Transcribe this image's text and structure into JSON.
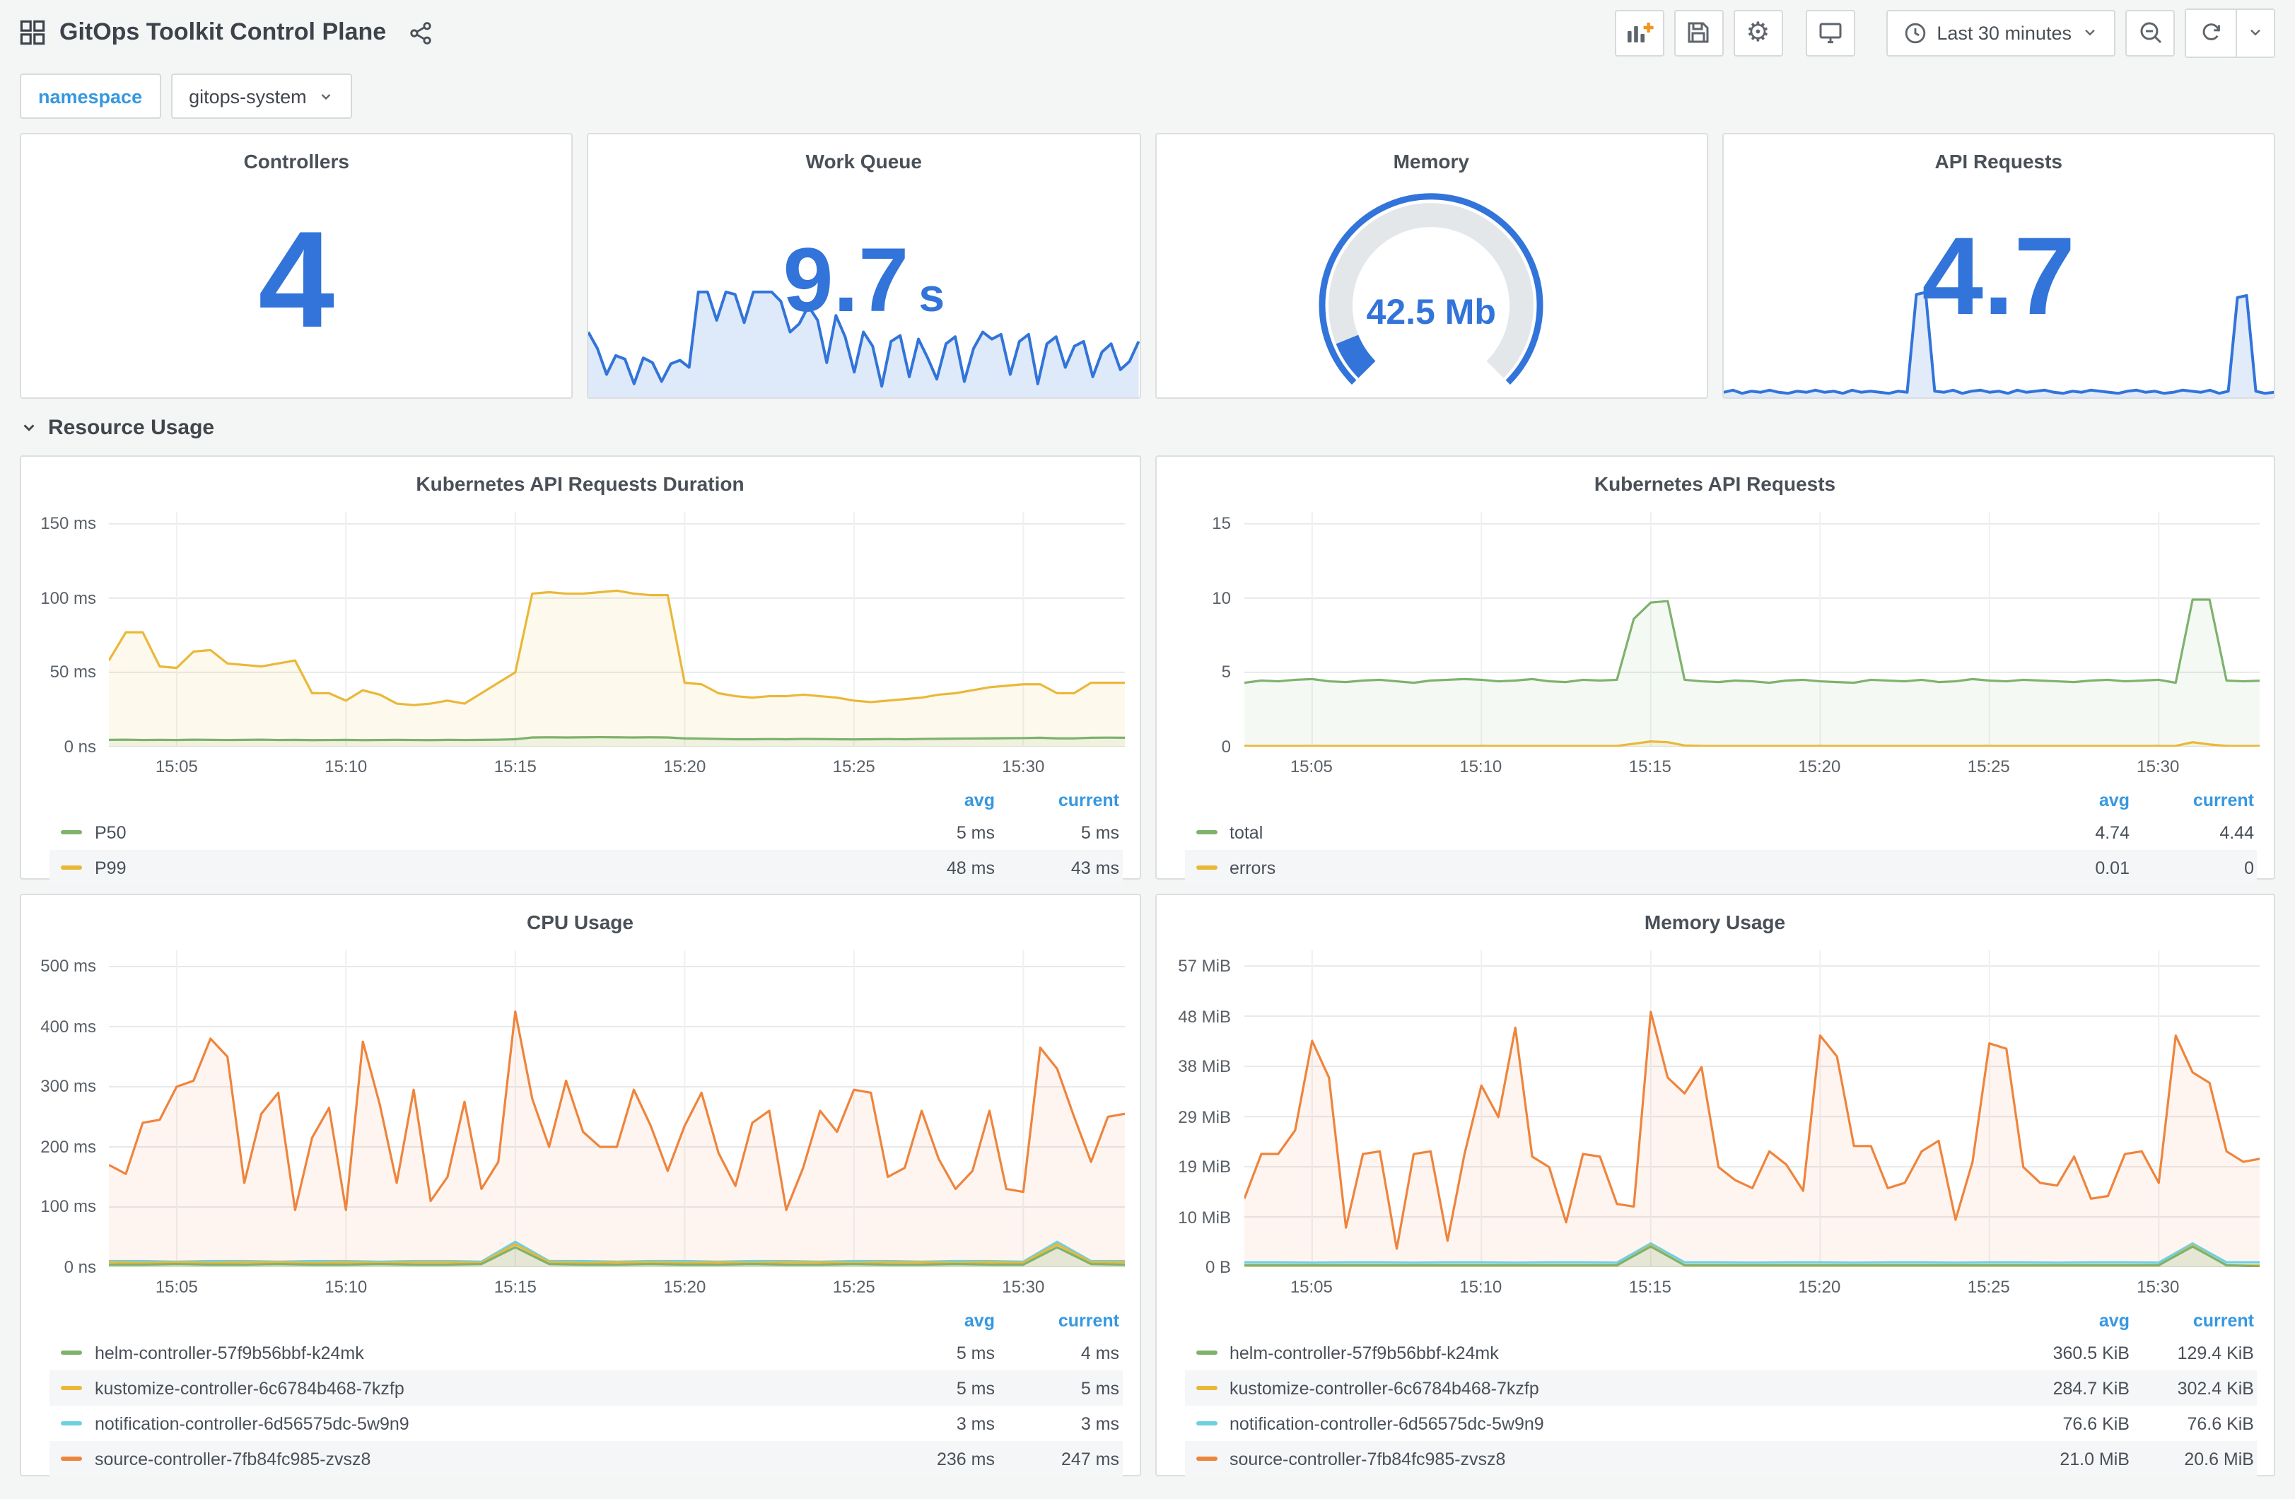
{
  "header": {
    "title": "GitOps Toolkit Control Plane",
    "time_range": "Last 30 minutes"
  },
  "variables": {
    "label": "namespace",
    "value": "gitops-system"
  },
  "row_section": {
    "title": "Resource Usage"
  },
  "legend": {
    "avg_label": "avg",
    "current_label": "current"
  },
  "colors": {
    "accent_blue": "#3274D9",
    "link_blue": "#3698e0",
    "green": "#7EB26D",
    "yellow": "#EAB839",
    "cyan": "#6ED0E0",
    "orange": "#EF843C"
  },
  "stats": [
    {
      "title": "Controllers",
      "value": "4"
    },
    {
      "title": "Work Queue",
      "value": "9.7",
      "unit": "s",
      "spark": {
        "max": 10.5,
        "color": "#3274D9",
        "fill_opacity": 0.16,
        "values": [
          5.6,
          4.2,
          2.0,
          3.6,
          3.3,
          1.2,
          3.4,
          3.0,
          1.4,
          2.9,
          3.2,
          2.6,
          9.0,
          9.0,
          6.6,
          9.0,
          8.8,
          6.4,
          9.0,
          9.0,
          9.0,
          8.2,
          5.6,
          6.3,
          7.8,
          6.6,
          3.0,
          7.0,
          5.2,
          2.2,
          5.6,
          4.4,
          1.0,
          4.8,
          5.3,
          1.8,
          5.0,
          3.4,
          1.6,
          4.6,
          5.2,
          1.4,
          4.2,
          5.6,
          5.0,
          5.4,
          2.0,
          4.8,
          5.4,
          1.2,
          4.6,
          5.2,
          2.6,
          4.4,
          4.8,
          1.8,
          3.9,
          4.6,
          2.4,
          3.1,
          4.8
        ]
      }
    },
    {
      "title": "Memory",
      "value": "42.5 Mb",
      "gauge": {
        "fraction": 0.085
      }
    },
    {
      "title": "API Requests",
      "value": "4.7",
      "spark": {
        "max": 10.5,
        "color": "#3274D9",
        "fill_opacity": 0.14,
        "values": [
          0.5,
          0.7,
          0.4,
          0.6,
          0.5,
          0.7,
          0.5,
          0.4,
          0.6,
          0.5,
          0.7,
          0.5,
          0.6,
          0.4,
          0.7,
          0.5,
          0.6,
          0.5,
          0.4,
          0.6,
          0.5,
          9.8,
          10,
          0.6,
          0.5,
          0.7,
          0.4,
          0.6,
          0.7,
          0.5,
          0.6,
          0.4,
          0.7,
          0.5,
          0.6,
          0.7,
          0.5,
          0.4,
          0.6,
          0.5,
          0.7,
          0.6,
          0.5,
          0.4,
          0.6,
          0.7,
          0.5,
          0.6,
          0.4,
          0.5,
          0.7,
          0.6,
          0.5,
          0.7,
          0.4,
          0.6,
          9.5,
          9.7,
          0.6,
          0.4,
          0.5
        ]
      }
    }
  ],
  "chart_data": [
    {
      "type": "line",
      "title": "Kubernetes API Requests Duration",
      "time_domain": [
        "15:03",
        "15:33"
      ],
      "ymax": 158,
      "y_ticks": [
        {
          "value": 0,
          "label": "0 ns"
        },
        {
          "value": 50,
          "label": "50 ms"
        },
        {
          "value": 100,
          "label": "100 ms"
        },
        {
          "value": 150,
          "label": "150 ms"
        }
      ],
      "x_ticks": [
        {
          "frac": 0.0667,
          "label": "15:05"
        },
        {
          "frac": 0.2333,
          "label": "15:10"
        },
        {
          "frac": 0.4,
          "label": "15:15"
        },
        {
          "frac": 0.5667,
          "label": "15:20"
        },
        {
          "frac": 0.7333,
          "label": "15:25"
        },
        {
          "frac": 0.9,
          "label": "15:30"
        }
      ],
      "draw_order": [
        1,
        0
      ],
      "series": [
        {
          "name": "P50",
          "color": "#7EB26D",
          "fill_opacity": 0.1,
          "avg": "5 ms",
          "current": "5 ms",
          "values": [
            4.6,
            4.7,
            4.5,
            4.6,
            4.5,
            4.7,
            4.6,
            4.5,
            4.6,
            4.7,
            4.5,
            4.6,
            4.4,
            4.5,
            4.6,
            4.4,
            4.5,
            4.6,
            4.5,
            4.4,
            4.6,
            4.5,
            4.6,
            4.7,
            5.0,
            6.2,
            6.3,
            6.2,
            6.3,
            6.4,
            6.3,
            6.2,
            6.3,
            6.2,
            5.6,
            5.4,
            5.2,
            5.0,
            5.0,
            5.1,
            5.0,
            5.2,
            5.1,
            5.0,
            4.9,
            5.0,
            5.1,
            5.0,
            5.2,
            5.3,
            5.4,
            5.5,
            5.6,
            5.7,
            5.8,
            6.0,
            5.6,
            5.6,
            6.0,
            6.1,
            6.0
          ]
        },
        {
          "name": "P99",
          "color": "#EAB839",
          "fill_opacity": 0.09,
          "avg": "48 ms",
          "current": "43 ms",
          "values": [
            58,
            77,
            77,
            54,
            53,
            64,
            65,
            56,
            55,
            54,
            56,
            58,
            36,
            36,
            31,
            38,
            35,
            29,
            28,
            29,
            31,
            29,
            36,
            43,
            50,
            103,
            104,
            103,
            103,
            104,
            105,
            103,
            102,
            102,
            43,
            42,
            36,
            34,
            33,
            34,
            34,
            35,
            34,
            33,
            31,
            30,
            31,
            32,
            33,
            35,
            36,
            38,
            40,
            41,
            42,
            42,
            36,
            36,
            43,
            43,
            43
          ]
        }
      ]
    },
    {
      "type": "line",
      "title": "Kubernetes API Requests",
      "time_domain": [
        "15:03",
        "15:33"
      ],
      "ymax": 15.8,
      "y_ticks": [
        {
          "value": 0,
          "label": "0"
        },
        {
          "value": 5,
          "label": "5"
        },
        {
          "value": 10,
          "label": "10"
        },
        {
          "value": 15,
          "label": "15"
        }
      ],
      "x_ticks": [
        {
          "frac": 0.0667,
          "label": "15:05"
        },
        {
          "frac": 0.2333,
          "label": "15:10"
        },
        {
          "frac": 0.4,
          "label": "15:15"
        },
        {
          "frac": 0.5667,
          "label": "15:20"
        },
        {
          "frac": 0.7333,
          "label": "15:25"
        },
        {
          "frac": 0.9,
          "label": "15:30"
        }
      ],
      "draw_order": [
        0,
        1
      ],
      "series": [
        {
          "name": "total",
          "color": "#7EB26D",
          "fill_opacity": 0.08,
          "avg": "4.74",
          "current": "4.44",
          "values": [
            4.3,
            4.45,
            4.4,
            4.5,
            4.55,
            4.4,
            4.35,
            4.45,
            4.5,
            4.4,
            4.3,
            4.45,
            4.5,
            4.55,
            4.5,
            4.4,
            4.45,
            4.55,
            4.4,
            4.35,
            4.5,
            4.45,
            4.5,
            8.6,
            9.7,
            9.8,
            4.5,
            4.4,
            4.35,
            4.45,
            4.4,
            4.3,
            4.45,
            4.5,
            4.4,
            4.35,
            4.3,
            4.5,
            4.45,
            4.4,
            4.5,
            4.35,
            4.4,
            4.55,
            4.45,
            4.4,
            4.5,
            4.45,
            4.4,
            4.35,
            4.45,
            4.5,
            4.4,
            4.45,
            4.5,
            4.3,
            9.9,
            9.9,
            4.45,
            4.4,
            4.44
          ]
        },
        {
          "name": "errors",
          "color": "#EAB839",
          "fill_opacity": 0.12,
          "avg": "0.01",
          "current": "0",
          "values": [
            0.05,
            0.05,
            0.05,
            0.05,
            0.05,
            0.05,
            0.05,
            0.05,
            0.05,
            0.05,
            0.05,
            0.05,
            0.05,
            0.05,
            0.05,
            0.05,
            0.05,
            0.05,
            0.05,
            0.05,
            0.05,
            0.05,
            0.05,
            0.2,
            0.35,
            0.3,
            0.08,
            0.05,
            0.05,
            0.05,
            0.05,
            0.05,
            0.05,
            0.05,
            0.05,
            0.05,
            0.05,
            0.05,
            0.05,
            0.05,
            0.05,
            0.05,
            0.05,
            0.05,
            0.05,
            0.05,
            0.05,
            0.05,
            0.05,
            0.05,
            0.05,
            0.05,
            0.05,
            0.05,
            0.05,
            0.05,
            0.3,
            0.15,
            0.05,
            0.05,
            0.05
          ]
        }
      ]
    },
    {
      "type": "line",
      "title": "CPU Usage",
      "time_domain": [
        "15:03",
        "15:33"
      ],
      "ymax": 527,
      "y_ticks": [
        {
          "value": 0,
          "label": "0 ns"
        },
        {
          "value": 100,
          "label": "100 ms"
        },
        {
          "value": 200,
          "label": "200 ms"
        },
        {
          "value": 300,
          "label": "300 ms"
        },
        {
          "value": 400,
          "label": "400 ms"
        },
        {
          "value": 500,
          "label": "500 ms"
        }
      ],
      "x_ticks": [
        {
          "frac": 0.0667,
          "label": "15:05"
        },
        {
          "frac": 0.2333,
          "label": "15:10"
        },
        {
          "frac": 0.4,
          "label": "15:15"
        },
        {
          "frac": 0.5667,
          "label": "15:20"
        },
        {
          "frac": 0.7333,
          "label": "15:25"
        },
        {
          "frac": 0.9,
          "label": "15:30"
        }
      ],
      "draw_order": [
        3,
        2,
        1,
        0
      ],
      "series": [
        {
          "name": "helm-controller-57f9b56bbf-k24mk",
          "color": "#7EB26D",
          "fill_opacity": 0.1,
          "avg": "5 ms",
          "current": "4 ms",
          "values": [
            4,
            4,
            5,
            4,
            4,
            5,
            4,
            4,
            5,
            4,
            4,
            5,
            33,
            5,
            4,
            4,
            5,
            4,
            4,
            5,
            4,
            4,
            5,
            4,
            4,
            5,
            4,
            4,
            33,
            5,
            4
          ]
        },
        {
          "name": "kustomize-controller-6c6784b468-7kzfp",
          "color": "#EAB839",
          "fill_opacity": 0.08,
          "avg": "5 ms",
          "current": "5 ms",
          "values": [
            8,
            7,
            8,
            7,
            8,
            8,
            7,
            8,
            7,
            8,
            8,
            7,
            38,
            8,
            7,
            8,
            8,
            7,
            8,
            7,
            8,
            8,
            7,
            8,
            8,
            7,
            8,
            7,
            38,
            8,
            8
          ]
        },
        {
          "name": "notification-controller-6d56575dc-5w9n9",
          "color": "#6ED0E0",
          "fill_opacity": 0.08,
          "avg": "3 ms",
          "current": "3 ms",
          "values": [
            10,
            10,
            9,
            10,
            10,
            9,
            10,
            10,
            9,
            10,
            10,
            9,
            42,
            10,
            10,
            9,
            10,
            10,
            9,
            10,
            10,
            9,
            10,
            10,
            9,
            10,
            10,
            9,
            42,
            10,
            10
          ]
        },
        {
          "name": "source-controller-7fb84fc985-zvsz8",
          "color": "#EF843C",
          "fill_opacity": 0.08,
          "avg": "236 ms",
          "current": "247 ms",
          "values": [
            170,
            155,
            240,
            245,
            300,
            310,
            380,
            350,
            140,
            255,
            290,
            95,
            215,
            265,
            95,
            375,
            270,
            140,
            295,
            110,
            150,
            275,
            130,
            175,
            425,
            280,
            200,
            310,
            225,
            200,
            200,
            295,
            235,
            160,
            235,
            290,
            190,
            135,
            240,
            260,
            95,
            165,
            260,
            225,
            295,
            290,
            150,
            165,
            260,
            180,
            130,
            160,
            260,
            130,
            125,
            365,
            330,
            250,
            175,
            250,
            255
          ]
        }
      ]
    },
    {
      "type": "line",
      "title": "Memory Usage",
      "time_domain": [
        "15:03",
        "15:33"
      ],
      "ymax": 60.2,
      "y_ticks": [
        {
          "value": 0,
          "label": "0 B"
        },
        {
          "value": 9.54,
          "label": "10 MiB"
        },
        {
          "value": 19.07,
          "label": "19 MiB"
        },
        {
          "value": 28.61,
          "label": "29 MiB"
        },
        {
          "value": 38.15,
          "label": "38 MiB"
        },
        {
          "value": 47.68,
          "label": "48 MiB"
        },
        {
          "value": 57.22,
          "label": "57 MiB"
        }
      ],
      "x_ticks": [
        {
          "frac": 0.0667,
          "label": "15:05"
        },
        {
          "frac": 0.2333,
          "label": "15:10"
        },
        {
          "frac": 0.4,
          "label": "15:15"
        },
        {
          "frac": 0.5667,
          "label": "15:20"
        },
        {
          "frac": 0.7333,
          "label": "15:25"
        },
        {
          "frac": 0.9,
          "label": "15:30"
        }
      ],
      "draw_order": [
        3,
        2,
        1,
        0
      ],
      "series": [
        {
          "name": "helm-controller-57f9b56bbf-k24mk",
          "color": "#7EB26D",
          "fill_opacity": 0.1,
          "avg": "360.5 KiB",
          "current": "129.4 KiB",
          "values": [
            0.36,
            0.36,
            0.36,
            0.36,
            0.36,
            0.36,
            0.36,
            0.36,
            0.36,
            0.36,
            0.36,
            0.36,
            3.9,
            0.36,
            0.36,
            0.36,
            0.36,
            0.36,
            0.36,
            0.36,
            0.36,
            0.36,
            0.36,
            0.36,
            0.36,
            0.36,
            0.36,
            0.36,
            3.9,
            0.36,
            0.13
          ]
        },
        {
          "name": "kustomize-controller-6c6784b468-7kzfp",
          "color": "#EAB839",
          "fill_opacity": 0.08,
          "avg": "284.7 KiB",
          "current": "302.4 KiB",
          "values": [
            0.3,
            0.3,
            0.3,
            0.3,
            0.3,
            0.3,
            0.3,
            0.3,
            0.3,
            0.3,
            0.3,
            0.3,
            4.1,
            0.3,
            0.3,
            0.3,
            0.3,
            0.3,
            0.3,
            0.3,
            0.3,
            0.3,
            0.3,
            0.3,
            0.3,
            0.3,
            0.3,
            0.3,
            4.1,
            0.3,
            0.3
          ]
        },
        {
          "name": "notification-controller-6d56575dc-5w9n9",
          "color": "#6ED0E0",
          "fill_opacity": 0.08,
          "avg": "76.6 KiB",
          "current": "76.6 KiB",
          "values": [
            0.9,
            0.9,
            0.85,
            0.9,
            0.9,
            0.85,
            0.9,
            0.9,
            0.85,
            0.9,
            0.9,
            0.85,
            4.5,
            0.9,
            0.9,
            0.85,
            0.9,
            0.9,
            0.85,
            0.9,
            0.9,
            0.85,
            0.9,
            0.9,
            0.85,
            0.9,
            0.9,
            0.85,
            4.5,
            0.9,
            0.9
          ]
        },
        {
          "name": "source-controller-7fb84fc985-zvsz8",
          "color": "#EF843C",
          "fill_opacity": 0.08,
          "avg": "21.0 MiB",
          "current": "20.6 MiB",
          "values": [
            13,
            21.5,
            21.5,
            26,
            43,
            36,
            7.5,
            21.5,
            22,
            3.5,
            21.5,
            22,
            5,
            21.5,
            34.5,
            28.5,
            45.5,
            21,
            19,
            8.5,
            21.5,
            21,
            12,
            11.5,
            48.5,
            36,
            33,
            38,
            19,
            16.5,
            15,
            22,
            19.5,
            14.5,
            44,
            40,
            23,
            23,
            15,
            16,
            22,
            24,
            9,
            20,
            42.5,
            41.5,
            19,
            16,
            15.5,
            21,
            13,
            13.5,
            21.5,
            22,
            16,
            44,
            37,
            35,
            22,
            20,
            20.6
          ]
        }
      ]
    }
  ]
}
